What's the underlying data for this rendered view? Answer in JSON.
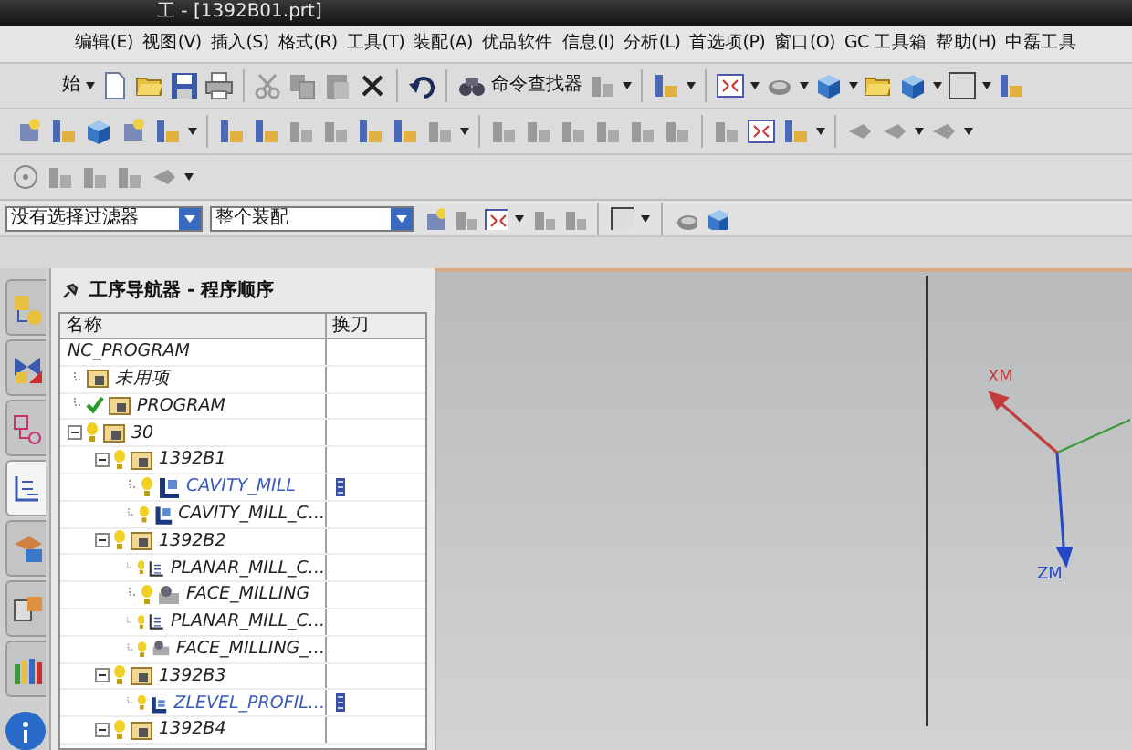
{
  "window": {
    "title": "工 - [1392B01.prt]"
  },
  "menu": [
    "编辑(E)",
    "视图(V)",
    "插入(S)",
    "格式(R)",
    "工具(T)",
    "装配(A)",
    "优品软件",
    "信息(I)",
    "分析(L)",
    "首选项(P)",
    "窗口(O)",
    "GC 工具箱",
    "帮助(H)",
    "中磊工具"
  ],
  "toolbar": {
    "start_label": "始",
    "command_finder": "命令查找器"
  },
  "filter_bar": {
    "type_filter": "没有选择过滤器",
    "scope": "整个装配"
  },
  "side_tabs": [
    {
      "selected": false
    },
    {
      "selected": false
    },
    {
      "selected": false
    },
    {
      "selected": true
    },
    {
      "selected": false
    },
    {
      "selected": false
    },
    {
      "selected": false
    }
  ],
  "navigator": {
    "title": "工序导航器 - 程序顺序",
    "columns": [
      "名称",
      "换刀"
    ],
    "tree": [
      {
        "name": "NC_PROGRAM",
        "kind": "root",
        "children": [
          {
            "name": "未用项",
            "kind": "group",
            "bulb": false,
            "check": false,
            "tool_change": false
          },
          {
            "name": "PROGRAM",
            "kind": "group",
            "bulb": false,
            "check": true,
            "tool_change": false
          },
          {
            "name": "30",
            "kind": "group",
            "bulb": true,
            "check": false,
            "tool_change": false,
            "expanded": true,
            "children": [
              {
                "name": "1392B1",
                "kind": "group",
                "bulb": true,
                "check": false,
                "tool_change": false,
                "expanded": true,
                "children": [
                  {
                    "name": "CAVITY_MILL",
                    "kind": "cavity",
                    "bulb": true,
                    "check": false,
                    "tool_change": true
                  },
                  {
                    "name": "CAVITY_MILL_C...",
                    "kind": "cavity",
                    "bulb": true,
                    "check": false,
                    "tool_change": false
                  }
                ]
              },
              {
                "name": "1392B2",
                "kind": "group",
                "bulb": true,
                "check": false,
                "tool_change": false,
                "expanded": true,
                "children": [
                  {
                    "name": "PLANAR_MILL_C...",
                    "kind": "planar",
                    "bulb": true,
                    "check": false,
                    "tool_change": false
                  },
                  {
                    "name": "FACE_MILLING",
                    "kind": "face",
                    "bulb": true,
                    "check": false,
                    "tool_change": false
                  },
                  {
                    "name": "PLANAR_MILL_C...",
                    "kind": "planar",
                    "bulb": true,
                    "check": false,
                    "tool_change": false
                  },
                  {
                    "name": "FACE_MILLING_...",
                    "kind": "face",
                    "bulb": true,
                    "check": false,
                    "tool_change": false
                  }
                ]
              },
              {
                "name": "1392B3",
                "kind": "group",
                "bulb": true,
                "check": false,
                "tool_change": false,
                "expanded": true,
                "children": [
                  {
                    "name": "ZLEVEL_PROFIL...",
                    "kind": "zlevel",
                    "bulb": true,
                    "check": false,
                    "tool_change": true
                  }
                ]
              },
              {
                "name": "1392B4",
                "kind": "group",
                "bulb": true,
                "check": false,
                "tool_change": false,
                "expanded": true
              }
            ]
          }
        ]
      }
    ]
  },
  "viewport": {
    "axes": [
      {
        "label": "XM",
        "color": "#c43c3c"
      },
      {
        "label": "ZM",
        "color": "#2448c8"
      }
    ]
  }
}
